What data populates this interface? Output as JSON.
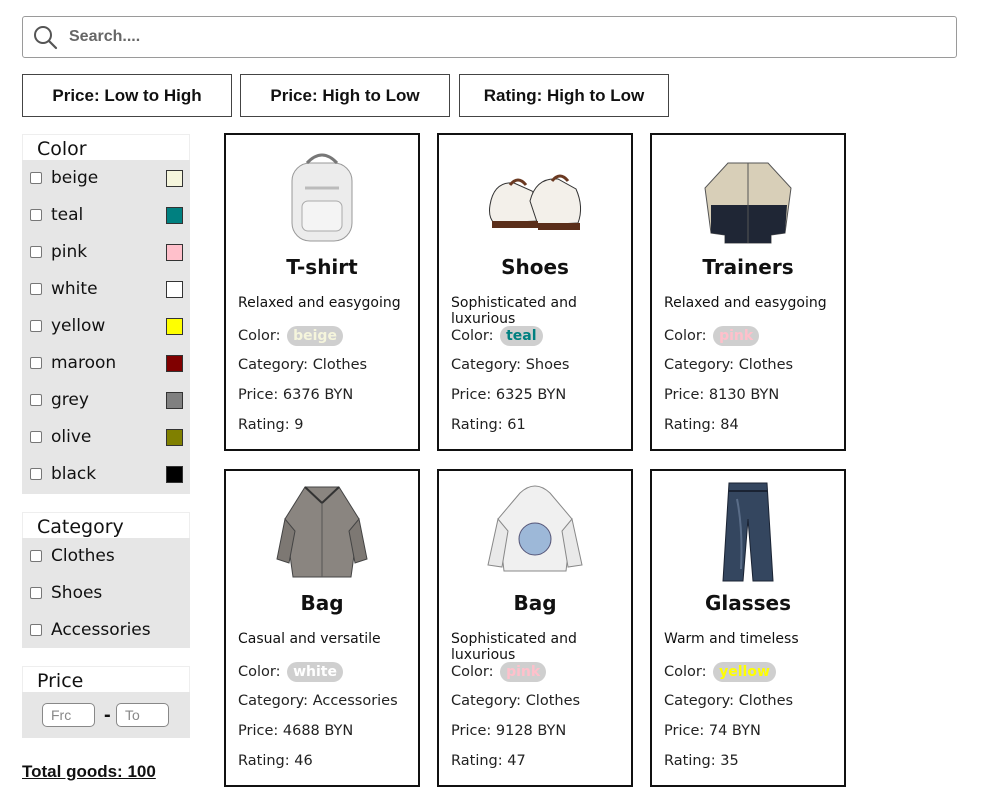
{
  "search": {
    "placeholder": "Search...."
  },
  "sort": [
    {
      "label": "Price: Low to High"
    },
    {
      "label": "Price: High to Low"
    },
    {
      "label": "Rating: High to Low"
    }
  ],
  "filters": {
    "color": {
      "title": "Color",
      "options": [
        {
          "label": "beige",
          "swatch": "#f5f5dc"
        },
        {
          "label": "teal",
          "swatch": "#008080"
        },
        {
          "label": "pink",
          "swatch": "#ffc0cb"
        },
        {
          "label": "white",
          "swatch": "#ffffff"
        },
        {
          "label": "yellow",
          "swatch": "#ffff00"
        },
        {
          "label": "maroon",
          "swatch": "#800000"
        },
        {
          "label": "grey",
          "swatch": "#808080"
        },
        {
          "label": "olive",
          "swatch": "#808000"
        },
        {
          "label": "black",
          "swatch": "#000000"
        }
      ]
    },
    "category": {
      "title": "Category",
      "options": [
        {
          "label": "Clothes"
        },
        {
          "label": "Shoes"
        },
        {
          "label": "Accessories"
        }
      ]
    },
    "price": {
      "title": "Price",
      "from_placeholder": "Frc",
      "to_placeholder": "To",
      "separator": "-"
    }
  },
  "total": "Total goods: 100",
  "labels": {
    "color": "Color:",
    "category": "Category: ",
    "price": "Price: ",
    "rating": "Rating: ",
    "currency": " BYN"
  },
  "products": [
    {
      "title": "T-shirt",
      "desc": "Relaxed and easygoing",
      "color": "beige",
      "color_hex": "#f5f5dc",
      "category": "Clothes",
      "price": "6376",
      "rating": "9",
      "icon": "backpack-image"
    },
    {
      "title": "Shoes",
      "desc": "Sophisticated and luxurious",
      "color": "teal",
      "color_hex": "#008080",
      "category": "Shoes",
      "price": "6325",
      "rating": "61",
      "icon": "shoes-image"
    },
    {
      "title": "Trainers",
      "desc": "Relaxed and easygoing",
      "color": "pink",
      "color_hex": "#ffc0cb",
      "category": "Clothes",
      "price": "8130",
      "rating": "84",
      "icon": "jacket-image"
    },
    {
      "title": "Bag",
      "desc": "Casual and versatile",
      "color": "white",
      "color_hex": "#ffffff",
      "category": "Accessories",
      "price": "4688",
      "rating": "46",
      "icon": "shirt-image"
    },
    {
      "title": "Bag",
      "desc": "Sophisticated and luxurious",
      "color": "pink",
      "color_hex": "#ffc0cb",
      "category": "Clothes",
      "price": "9128",
      "rating": "47",
      "icon": "hoodie-image"
    },
    {
      "title": "Glasses",
      "desc": "Warm and timeless",
      "color": "yellow",
      "color_hex": "#ffff00",
      "category": "Clothes",
      "price": "74",
      "rating": "35",
      "icon": "jeans-image"
    }
  ]
}
